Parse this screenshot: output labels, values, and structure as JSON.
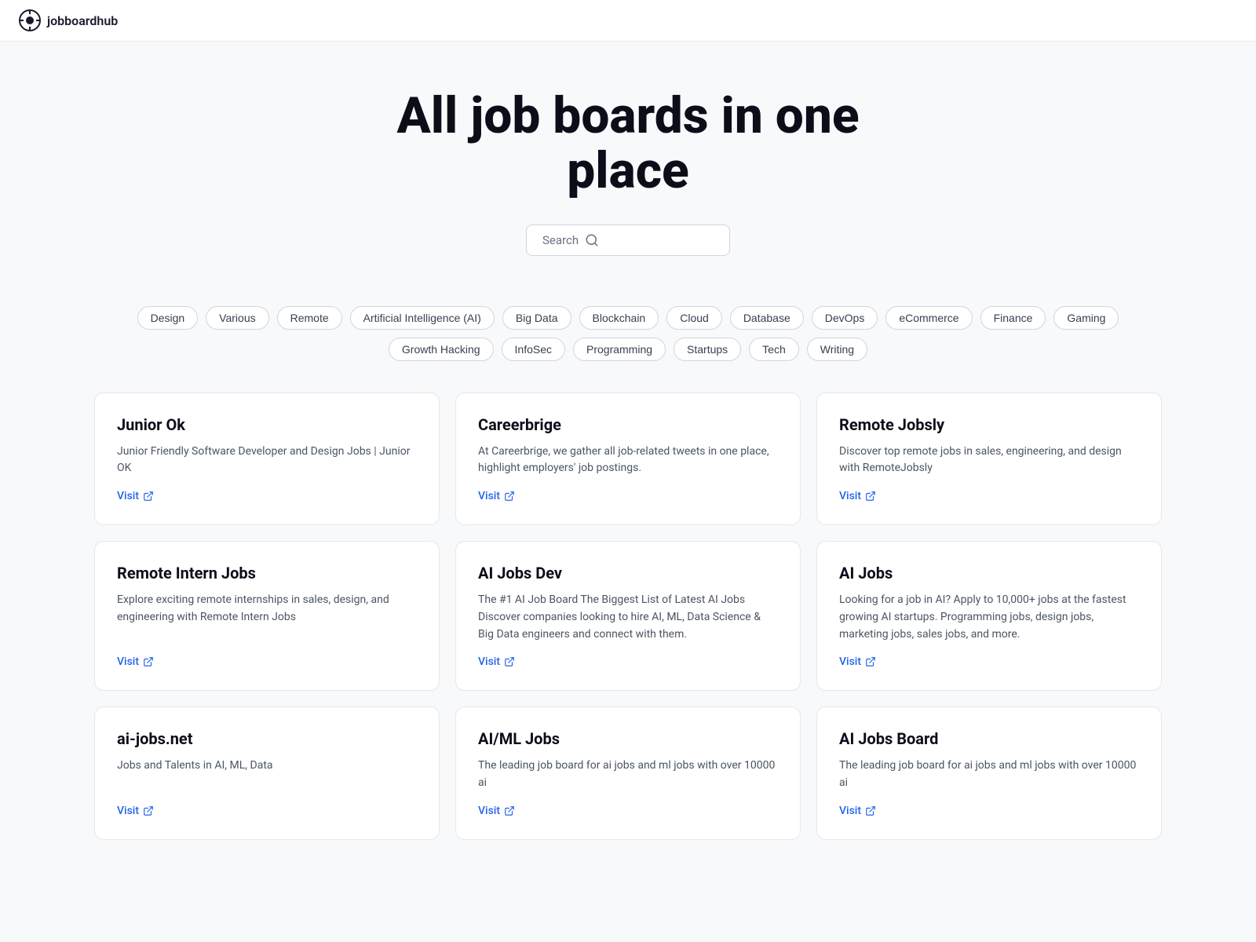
{
  "header": {
    "logo_alt": "jobboardhub logo",
    "site_name": "jobboardhub"
  },
  "hero": {
    "title": "All job boards in one place",
    "search_placeholder": "Search"
  },
  "tags": [
    "Design",
    "Various",
    "Remote",
    "Artificial Intelligence (AI)",
    "Big Data",
    "Blockchain",
    "Cloud",
    "Database",
    "DevOps",
    "eCommerce",
    "Finance",
    "Gaming",
    "Growth Hacking",
    "InfoSec",
    "Programming",
    "Startups",
    "Tech",
    "Writing"
  ],
  "cards": [
    {
      "title": "Junior Ok",
      "description": "Junior Friendly Software Developer and Design Jobs | Junior OK",
      "visit_label": "Visit"
    },
    {
      "title": "Careerbrige",
      "description": "At Careerbrige, we gather all job-related tweets in one place, highlight employers' job postings.",
      "visit_label": "Visit"
    },
    {
      "title": "Remote Jobsly",
      "description": "Discover top remote jobs in sales, engineering, and design with RemoteJobsly",
      "visit_label": "Visit"
    },
    {
      "title": "Remote Intern Jobs",
      "description": "Explore exciting remote internships in sales, design, and engineering with Remote Intern Jobs",
      "visit_label": "Visit"
    },
    {
      "title": "AI Jobs Dev",
      "description": "The #1 AI Job Board The Biggest List of Latest AI Jobs Discover companies looking to hire AI, ML, Data Science & Big Data engineers and connect with them.",
      "visit_label": "Visit"
    },
    {
      "title": "AI Jobs",
      "description": "Looking for a job in AI? Apply to 10,000+ jobs at the fastest growing AI startups. Programming jobs, design jobs, marketing jobs, sales jobs, and more.",
      "visit_label": "Visit"
    },
    {
      "title": "ai-jobs.net",
      "description": "Jobs and Talents in AI, ML, Data",
      "visit_label": "Visit"
    },
    {
      "title": "AI/ML Jobs",
      "description": "The leading job board for ai jobs and ml jobs with over 10000 ai",
      "visit_label": "Visit"
    },
    {
      "title": "AI Jobs Board",
      "description": "The leading job board for ai jobs and ml jobs with over 10000 ai",
      "visit_label": "Visit"
    }
  ]
}
